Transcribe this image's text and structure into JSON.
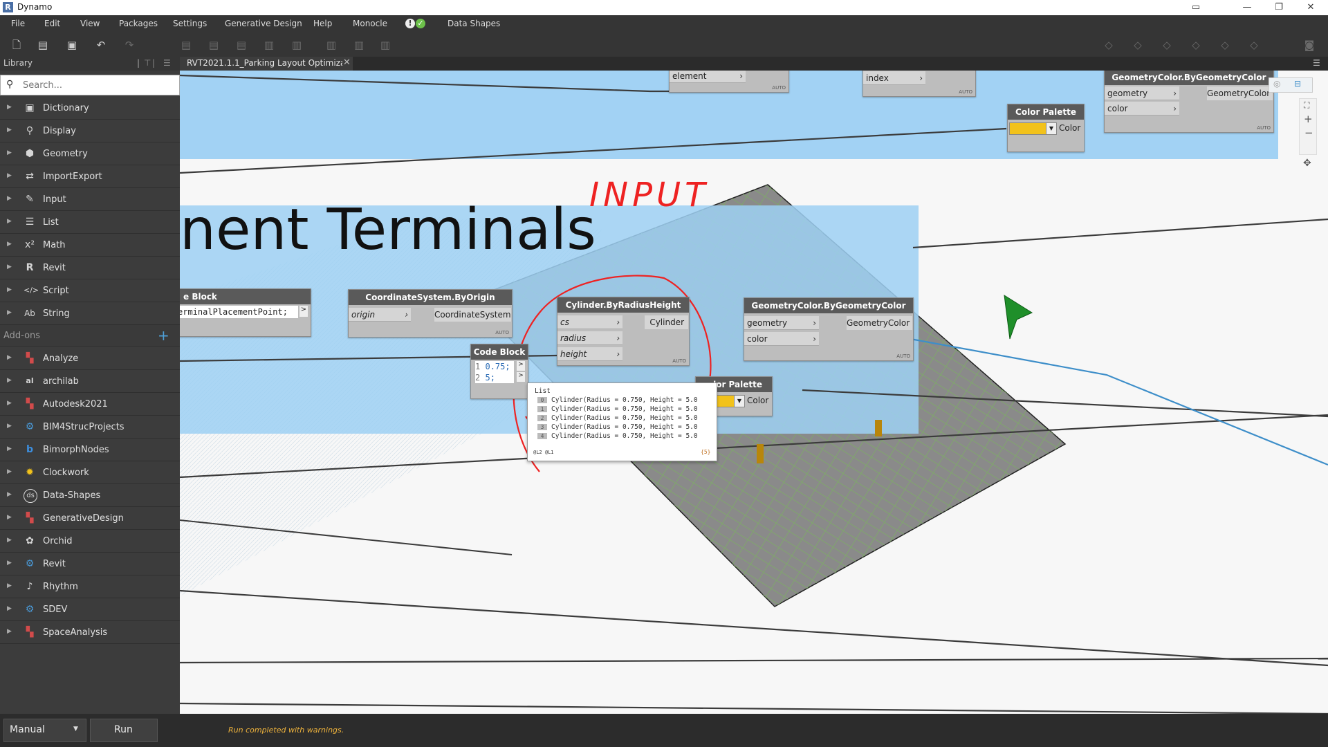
{
  "app": {
    "title": "Dynamo"
  },
  "menu": [
    "File",
    "Edit",
    "View",
    "Packages",
    "Settings",
    "Generative Design",
    "Help",
    "Monocle",
    "Data Shapes"
  ],
  "library": {
    "title": "Library",
    "search_placeholder": "Search...",
    "categories": [
      "Dictionary",
      "Display",
      "Geometry",
      "ImportExport",
      "Input",
      "List",
      "Math",
      "Revit",
      "Script",
      "String"
    ],
    "addons_label": "Add-ons",
    "addons": [
      "Analyze",
      "archilab",
      "Autodesk2021",
      "BIM4StrucProjects",
      "BimorphNodes",
      "Clockwork",
      "Data-Shapes",
      "GenerativeDesign",
      "Orchid",
      "Revit",
      "Rhythm",
      "SDEV",
      "SpaceAnalysis"
    ]
  },
  "tab": {
    "label": "RVT2021.1.1_Parking Layout Optimizati"
  },
  "canvas": {
    "group_title": "nent Terminals",
    "annotation": "INPUT",
    "nodes": {
      "top_element_port": "element",
      "top_index_port": "index",
      "gc_top": {
        "title": "GeometryColor.ByGeometryColor",
        "in1": "geometry",
        "in2": "color",
        "out": "GeometryColor"
      },
      "cp_top": {
        "title": "Color Palette",
        "out": "Color"
      },
      "code_left": {
        "title": "e Block",
        "code": "erminalPlacementPoint;"
      },
      "cs": {
        "title": "CoordinateSystem.ByOrigin",
        "in1": "origin",
        "out": "CoordinateSystem"
      },
      "code_mid": {
        "title": "Code Block",
        "line1_no": "1",
        "line1": "0.75;",
        "line2_no": "2",
        "line2": "5;"
      },
      "cyl": {
        "title": "Cylinder.ByRadiusHeight",
        "in1": "cs",
        "in2": "radius",
        "in3": "height",
        "out": "Cylinder"
      },
      "gc_mid": {
        "title": "GeometryColor.ByGeometryColor",
        "in1": "geometry",
        "in2": "color",
        "out": "GeometryColor"
      },
      "cp_mid": {
        "title": "olor Palette",
        "out": "Color"
      }
    },
    "auto_label": "AUTO",
    "preview": {
      "header": "List",
      "items": [
        {
          "idx": "0",
          "text": "Cylinder(Radius = 0.750, Height = 5.0"
        },
        {
          "idx": "1",
          "text": "Cylinder(Radius = 0.750, Height = 5.0"
        },
        {
          "idx": "2",
          "text": "Cylinder(Radius = 0.750, Height = 5.0"
        },
        {
          "idx": "3",
          "text": "Cylinder(Radius = 0.750, Height = 5.0"
        },
        {
          "idx": "4",
          "text": "Cylinder(Radius = 0.750, Height = 5.0"
        }
      ],
      "levels": "@L2 @L1",
      "count": "{5}"
    }
  },
  "statusbar": {
    "run_mode": "Manual",
    "run_label": "Run",
    "message": "Run completed with warnings."
  }
}
